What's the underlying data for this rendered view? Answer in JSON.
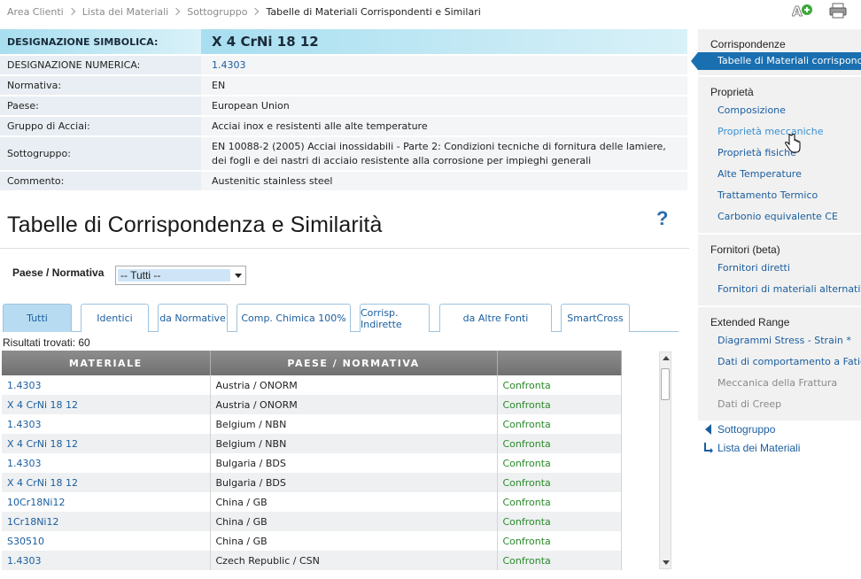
{
  "breadcrumb": [
    "Area Clienti",
    "Lista dei Materiali",
    "Sottogruppo",
    "Tabelle di Materiali Corrispondenti e Similari"
  ],
  "info": {
    "rows": [
      {
        "label": "DESIGNAZIONE SIMBOLICA:",
        "value": "X 4 CrNi 18 12"
      },
      {
        "label": "DESIGNAZIONE NUMERICA:",
        "value": "1.4303"
      },
      {
        "label": "Normativa:",
        "value": "EN"
      },
      {
        "label": "Paese:",
        "value": "European Union"
      },
      {
        "label": "Gruppo di Acciai:",
        "value": "Acciai inox e resistenti alle alte temperature"
      },
      {
        "label": "Sottogruppo:",
        "value": "EN 10088-2 (2005) Acciai inossidabili - Parte 2: Condizioni tecniche di fornitura delle lamiere, dei fogli e dei nastri di acciaio resistente alla corrosione per impieghi generali"
      },
      {
        "label": "Commento:",
        "value": "Austenitic stainless steel"
      }
    ]
  },
  "section_title": "Tabelle di Corrispondenza e Similarità",
  "help_icon": "?",
  "filter": {
    "label": "Paese / Normativa",
    "selected": "-- Tutti --"
  },
  "tabs": [
    "Tutti",
    "Identici",
    "da Normative",
    "Comp. Chimica 100%",
    "Corrisp. Indirette",
    "da Altre Fonti",
    "SmartCross"
  ],
  "results_label": "Risultati trovati: 60",
  "grid": {
    "headers": [
      "MATERIALE",
      "PAESE / NORMATIVA",
      ""
    ],
    "rows": [
      {
        "material": "1.4303",
        "country": "Austria / ONORM",
        "action": "Confronta"
      },
      {
        "material": "X 4 CrNi 18 12",
        "country": "Austria / ONORM",
        "action": "Confronta"
      },
      {
        "material": "1.4303",
        "country": "Belgium / NBN",
        "action": "Confronta"
      },
      {
        "material": "X 4 CrNi 18 12",
        "country": "Belgium / NBN",
        "action": "Confronta"
      },
      {
        "material": "1.4303",
        "country": "Bulgaria / BDS",
        "action": "Confronta"
      },
      {
        "material": "X 4 CrNi 18 12",
        "country": "Bulgaria / BDS",
        "action": "Confronta"
      },
      {
        "material": "10Cr18Ni12",
        "country": "China / GB",
        "action": "Confronta"
      },
      {
        "material": "1Cr18Ni12",
        "country": "China / GB",
        "action": "Confronta"
      },
      {
        "material": "S30510",
        "country": "China / GB",
        "action": "Confronta"
      },
      {
        "material": "1.4303",
        "country": "Czech Republic / CSN",
        "action": "Confronta"
      }
    ]
  },
  "sidebar": {
    "groups": [
      {
        "title": "Corrispondenze",
        "items": [
          "Tabelle di Materiali corrispondenti"
        ]
      },
      {
        "title": "Proprietà",
        "items": [
          "Composizione",
          "Proprietà meccaniche",
          "Proprietà fisiche",
          "Alte Temperature",
          "Trattamento Termico",
          "Carbonio equivalente CE"
        ]
      },
      {
        "title": "Fornitori (beta)",
        "items": [
          "Fornitori diretti",
          "Fornitori di materiali alternativi"
        ]
      },
      {
        "title": "Extended Range",
        "items": [
          "Diagrammi Stress - Strain *",
          "Dati di comportamento a Fatica *",
          "Meccanica della Frattura",
          "Dati di Creep"
        ]
      }
    ]
  },
  "back_links": [
    "Sottogruppo",
    "Lista dei Materiali"
  ],
  "colors": {
    "accent": "#1a6fb0",
    "link": "#1a5d9e",
    "compare": "#2a8a2a",
    "header_grad": "#a7def0"
  }
}
